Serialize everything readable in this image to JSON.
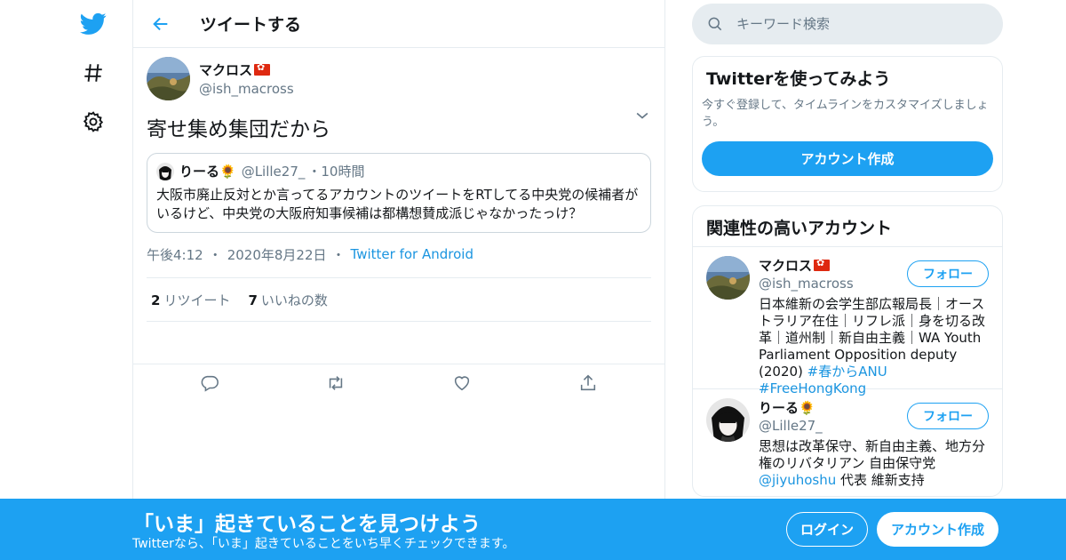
{
  "colors": {
    "accent": "#1da1f2",
    "link": "#1b95e0",
    "muted": "#657786",
    "border": "#e6ecf0"
  },
  "nav": {
    "icons": [
      "twitter-logo-icon",
      "hashtag-icon",
      "gear-icon"
    ]
  },
  "header": {
    "title": "ツイートする"
  },
  "tweet": {
    "author_name": "マクロス",
    "author_handle": "@ish_macross",
    "text": "寄せ集め集団だから",
    "quote": {
      "name": "りーる🌻",
      "handle": "@Lille27_",
      "sep": "・",
      "time": "10時間",
      "text": "大阪市廃止反対とか言ってるアカウントのツイートをRTしてる中央党の候補者がいるけど、中央党の大阪府知事候補は都構想賛成派じゃなかったっけ？"
    },
    "meta": {
      "time": "午後4:12",
      "date": "2020年8月22日",
      "source": "Twitter for Android",
      "sep": "・"
    },
    "stats": {
      "retweets": "2",
      "retweets_label": "リツイート",
      "likes": "7",
      "likes_label": "いいねの数"
    },
    "action_icons": [
      "reply-icon",
      "retweet-icon",
      "like-icon",
      "share-icon"
    ]
  },
  "search": {
    "placeholder": "キーワード検索"
  },
  "signup_card": {
    "title": "Twitterを使ってみよう",
    "subtitle": "今すぐ登録して、タイムラインをカスタマイズしましょう。",
    "button": "アカウント作成"
  },
  "related": {
    "title": "関連性の高いアカウント",
    "accounts": [
      {
        "name": "マクロス",
        "handle": "@ish_macross",
        "follow": "フォロー",
        "bio": "日本維新の会学生部広報局長｜オーストラリア在住｜リフレ派｜身を切る改革｜道州制｜新自由主義｜WA Youth Parliament Opposition deputy (2020) ",
        "bio_links": "#春からANU #FreeHongKong"
      },
      {
        "name": "りーる🌻",
        "handle": "@Lille27_",
        "follow": "フォロー",
        "bio": "思想は改革保守、新自由主義、地方分権のリバタリアン 自由保守党 ",
        "bio_link": "@jiyuhoshu",
        "bio_tail": " 代表 維新支持"
      }
    ]
  },
  "bottom_bar": {
    "title": "「いま」起きていることを見つけよう",
    "subtitle": "Twitterなら、「いま」起きていることをいち早くチェックできます。",
    "login": "ログイン",
    "signup": "アカウント作成"
  }
}
